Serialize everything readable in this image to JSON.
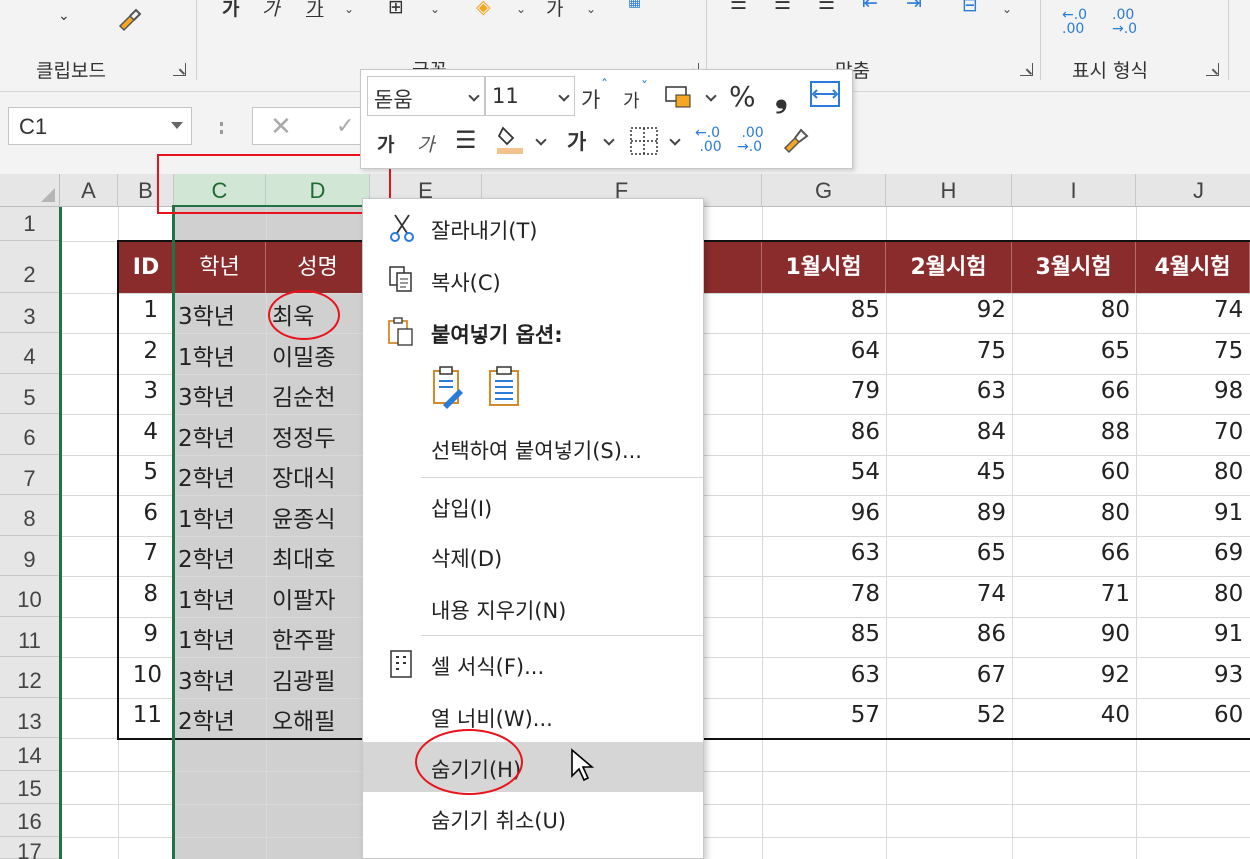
{
  "ribbon": {
    "groups": [
      {
        "label": "클립보드"
      },
      {
        "label": "글꼴"
      },
      {
        "label": "맞춤"
      },
      {
        "label": "표시 형식"
      }
    ],
    "format_icons": {
      "dec_left": "←.0\n.00",
      "dec_right": ".00\n→.0"
    }
  },
  "formula_bar": {
    "name_box": "C1",
    "cancel": "✕",
    "enter": "✓"
  },
  "mini_toolbar": {
    "font_name": "돋움",
    "font_size": "11",
    "grow_font": "가",
    "shrink_font": "가",
    "percent": "%",
    "comma": "❟",
    "bold": "가",
    "italic": "가",
    "bold2": "가"
  },
  "columns": [
    "A",
    "B",
    "C",
    "D",
    "E",
    "F",
    "G",
    "H",
    "I",
    "J"
  ],
  "rows": [
    "1",
    "2",
    "3",
    "4",
    "5",
    "6",
    "7",
    "8",
    "9",
    "10",
    "11",
    "12",
    "13",
    "14",
    "15",
    "16",
    "17"
  ],
  "table": {
    "headers": [
      "ID",
      "학년",
      "성명",
      "1월시험",
      "2월시험",
      "3월시험",
      "4월시험"
    ],
    "rows": [
      {
        "id": "1",
        "grade": "3학년",
        "name": "최욱",
        "m1": "85",
        "m2": "92",
        "m3": "80",
        "m4": "74"
      },
      {
        "id": "2",
        "grade": "1학년",
        "name": "이밀종",
        "m1": "64",
        "m2": "75",
        "m3": "65",
        "m4": "75"
      },
      {
        "id": "3",
        "grade": "3학년",
        "name": "김순천",
        "m1": "79",
        "m2": "63",
        "m3": "66",
        "m4": "98"
      },
      {
        "id": "4",
        "grade": "2학년",
        "name": "정정두",
        "m1": "86",
        "m2": "84",
        "m3": "88",
        "m4": "70"
      },
      {
        "id": "5",
        "grade": "2학년",
        "name": "장대식",
        "m1": "54",
        "m2": "45",
        "m3": "60",
        "m4": "80"
      },
      {
        "id": "6",
        "grade": "1학년",
        "name": "윤종식",
        "m1": "96",
        "m2": "89",
        "m3": "80",
        "m4": "91"
      },
      {
        "id": "7",
        "grade": "2학년",
        "name": "최대호",
        "m1": "63",
        "m2": "65",
        "m3": "66",
        "m4": "69"
      },
      {
        "id": "8",
        "grade": "1학년",
        "name": "이팔자",
        "m1": "78",
        "m2": "74",
        "m3": "71",
        "m4": "80"
      },
      {
        "id": "9",
        "grade": "1학년",
        "name": "한주팔",
        "m1": "85",
        "m2": "86",
        "m3": "90",
        "m4": "91"
      },
      {
        "id": "10",
        "grade": "3학년",
        "name": "김광필",
        "m1": "63",
        "m2": "67",
        "m3": "92",
        "m4": "93"
      },
      {
        "id": "11",
        "grade": "2학년",
        "name": "오해필",
        "m1": "57",
        "m2": "52",
        "m3": "40",
        "m4": "60"
      }
    ]
  },
  "context_menu": {
    "cut": "잘라내기(T)",
    "copy": "복사(C)",
    "paste_options": "붙여넣기 옵션:",
    "paste_special": "선택하여 붙여넣기(S)...",
    "insert": "삽입(I)",
    "delete": "삭제(D)",
    "clear": "내용 지우기(N)",
    "format_cells": "셀 서식(F)...",
    "column_width": "열 너비(W)...",
    "hide": "숨기기(H)",
    "unhide": "숨기기 취소(U)"
  },
  "colors": {
    "header_bg": "#8b2c2c",
    "selection_green": "#217346",
    "annotation_red": "#e8141c",
    "selected_cols_bg": "#d0d0d0"
  }
}
